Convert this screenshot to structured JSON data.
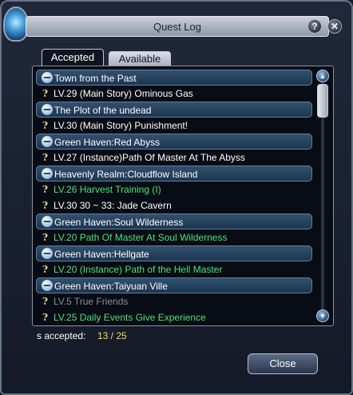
{
  "window": {
    "title": "Quest Log"
  },
  "header_buttons": {
    "help": "?",
    "close": "✕"
  },
  "tabs": [
    {
      "label": "Accepted",
      "active": true
    },
    {
      "label": "Available",
      "active": false
    }
  ],
  "quest_rows": [
    {
      "kind": "group",
      "label": "Town from the Past"
    },
    {
      "kind": "quest",
      "color": "white",
      "label": "LV.29 (Main Story) Ominous Gas"
    },
    {
      "kind": "group",
      "label": "The Plot of the undead"
    },
    {
      "kind": "quest",
      "color": "white",
      "label": "LV.30 (Main Story) Punishment!"
    },
    {
      "kind": "group",
      "label": "Green Haven:Red Abyss"
    },
    {
      "kind": "quest",
      "color": "white",
      "label": "LV.27 (Instance)Path Of Master At The Abyss"
    },
    {
      "kind": "group",
      "label": "Heavenly Realm:Cloudflow Island"
    },
    {
      "kind": "quest",
      "color": "green",
      "label": "LV.26 Harvest Training (I)"
    },
    {
      "kind": "quest",
      "color": "white",
      "label": "LV.30  30 ~ 33: Jade Cavern"
    },
    {
      "kind": "group",
      "label": "Green Haven:Soul Wilderness"
    },
    {
      "kind": "quest",
      "color": "green",
      "label": "LV.20 Path Of Master At Soul Wilderness"
    },
    {
      "kind": "group",
      "label": "Green Haven:Hellgate"
    },
    {
      "kind": "quest",
      "color": "green",
      "label": "LV.20 (Instance) Path of the Hell Master"
    },
    {
      "kind": "group",
      "label": "Green Haven:Taiyuan Ville"
    },
    {
      "kind": "quest",
      "color": "grey",
      "label": "LV.5 True Friends"
    },
    {
      "kind": "quest",
      "color": "green",
      "label": "LV.25 Daily Events Give Experience"
    }
  ],
  "colors": {
    "white": "#ffffff",
    "green": "#4ee07a",
    "grey": "#8a8f98",
    "count": "#f0e050"
  },
  "status": {
    "label": "s accepted:",
    "count": "13 / 25"
  },
  "footer": {
    "close_label": "Close"
  }
}
